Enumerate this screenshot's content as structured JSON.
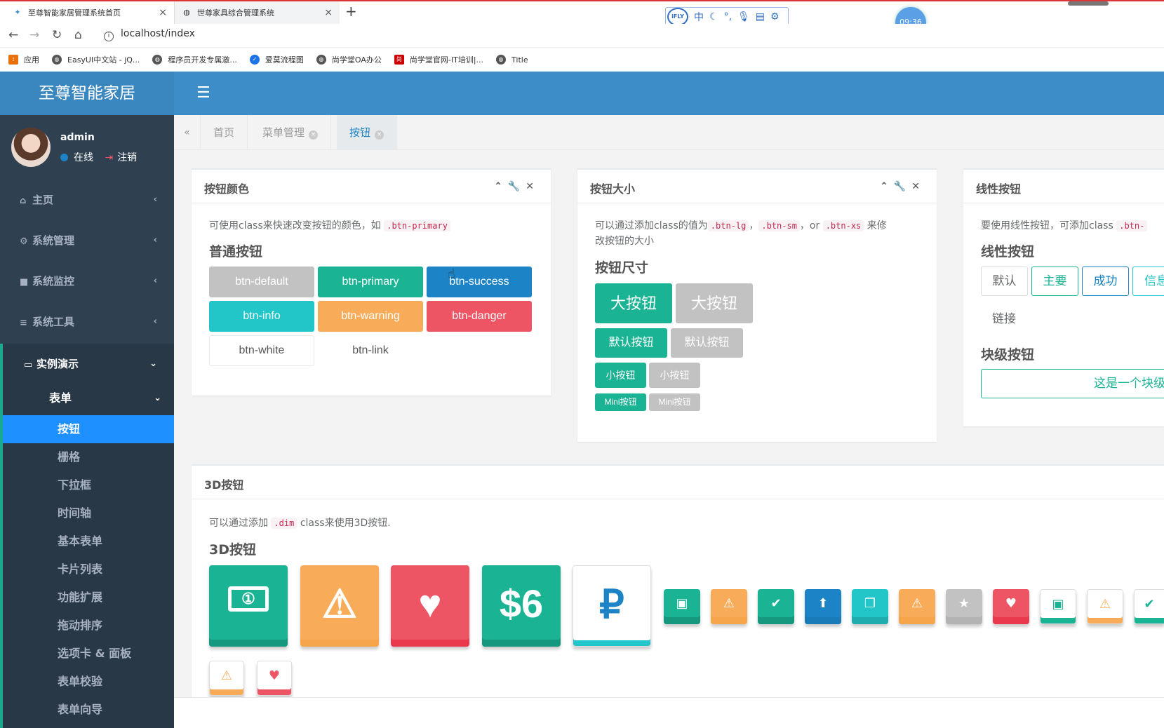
{
  "browser": {
    "tabs": [
      {
        "title": "至尊智能家居管理系统首页"
      },
      {
        "title": "世尊家具综合管理系统"
      }
    ],
    "new_tab": "+",
    "url": "localhost/index",
    "clock": "09:36",
    "ime": {
      "logo": "iFLY",
      "mode": "中"
    },
    "bookmarks": [
      "应用",
      "EasyUI中文站 - jQ...",
      "程序员开发专属激...",
      "爱莫流程图",
      "尚学堂OA办公",
      "尚学堂官网-IT培训|...",
      "Title"
    ]
  },
  "app": {
    "brand": "至尊智能家居",
    "user": {
      "name": "admin",
      "status": "在线",
      "logout": "注销"
    },
    "menu": [
      {
        "label": "主页",
        "icon": "home-icon"
      },
      {
        "label": "系统管理",
        "icon": "gear-icon"
      },
      {
        "label": "系统监控",
        "icon": "video-icon"
      },
      {
        "label": "系统工具",
        "icon": "list-icon"
      },
      {
        "label": "实例演示",
        "icon": "desktop-icon"
      }
    ],
    "submenu_group": "表单",
    "submenu": [
      "按钮",
      "栅格",
      "下拉框",
      "时间轴",
      "基本表单",
      "卡片列表",
      "功能扩展",
      "拖动排序",
      "选项卡 & 面板",
      "表单校验",
      "表单向导"
    ],
    "content_tabs": [
      {
        "label": "首页",
        "closable": false
      },
      {
        "label": "菜单管理",
        "closable": true
      },
      {
        "label": "按钮",
        "closable": true,
        "active": true
      }
    ]
  },
  "panels": {
    "colors": {
      "title": "按钮颜色",
      "desc_prefix": "可使用class来快速改变按钮的颜色，如",
      "desc_code": ".btn-primary",
      "heading": "普通按钮",
      "buttons": [
        "btn-default",
        "btn-primary",
        "btn-success",
        "btn-info",
        "btn-warning",
        "btn-danger",
        "btn-white",
        "btn-link"
      ]
    },
    "sizes": {
      "title": "按钮大小",
      "desc_1": "可以通过添加class的值为",
      "code_lg": ".btn-lg",
      "sep_1": "，",
      "code_sm": ".btn-sm",
      "sep_2": "，or",
      "code_xs": ".btn-xs",
      "desc_2": "来修",
      "desc_3": "改按钮的大小",
      "heading": "按钮尺寸",
      "large": "大按钮",
      "default": "默认按钮",
      "small": "小按钮",
      "mini": "Mini按钮"
    },
    "outline": {
      "title": "线性按钮",
      "desc": "要使用线性按钮，可添加class",
      "desc_code": ".btn-",
      "heading": "线性按钮",
      "buttons": [
        "默认",
        "主要",
        "成功",
        "信息"
      ],
      "link": "链接",
      "block_heading": "块级按钮",
      "block_button": "这是一个块级"
    },
    "dim": {
      "title": "3D按钮",
      "desc_prefix": "可以通过添加",
      "desc_code": ".dim",
      "desc_suffix": "class来使用3D按钮.",
      "heading": "3D按钮",
      "dollar_label": "$6",
      "ruble_label": "₽"
    }
  },
  "colors": {
    "primary": "#1ab394",
    "success": "#1c84c6",
    "info": "#23c6c8",
    "warning": "#f8ac59",
    "danger": "#ed5565",
    "default": "#c2c2c2",
    "sidebar": "#2f4050",
    "header": "#3d8ec8"
  }
}
